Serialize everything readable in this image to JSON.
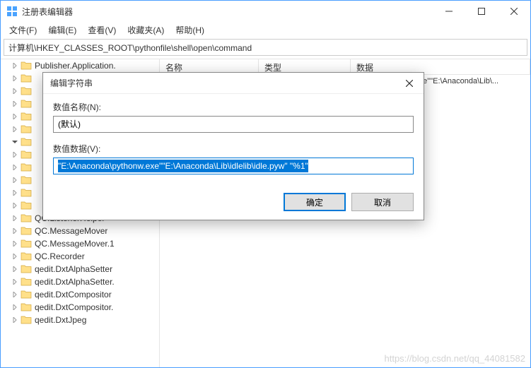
{
  "window": {
    "title": "注册表编辑器"
  },
  "titlebar_controls": {
    "min": "–",
    "max": "□",
    "close": "×"
  },
  "menu": {
    "file": "文件(F)",
    "edit": "编辑(E)",
    "view": "查看(V)",
    "favorites": "收藏夹(A)",
    "help": "帮助(H)"
  },
  "address": "计算机\\HKEY_CLASSES_ROOT\\pythonfile\\shell\\open\\command",
  "tree": [
    {
      "label": "Publisher.Application."
    },
    {
      "label": ""
    },
    {
      "label": ""
    },
    {
      "label": ""
    },
    {
      "label": ""
    },
    {
      "label": ""
    },
    {
      "label": "",
      "expanded": true
    },
    {
      "label": ""
    },
    {
      "label": ""
    },
    {
      "label": ""
    },
    {
      "label": ""
    },
    {
      "label": ""
    },
    {
      "label": "QC.ListenerHelper"
    },
    {
      "label": "QC.MessageMover"
    },
    {
      "label": "QC.MessageMover.1"
    },
    {
      "label": "QC.Recorder"
    },
    {
      "label": "qedit.DxtAlphaSetter"
    },
    {
      "label": "qedit.DxtAlphaSetter."
    },
    {
      "label": "qedit.DxtCompositor"
    },
    {
      "label": "qedit.DxtCompositor."
    },
    {
      "label": "qedit.DxtJpeg"
    }
  ],
  "list": {
    "headers": {
      "name": "名称",
      "type": "类型",
      "data": "数据"
    },
    "rows": [
      {
        "data": "aconda\\pythonw.exe\"\"E:\\Anaconda\\Lib\\..."
      }
    ]
  },
  "dialog": {
    "title": "编辑字符串",
    "name_label": "数值名称(N):",
    "name_value": "(默认)",
    "data_label": "数值数据(V):",
    "data_value": "\"E:\\Anaconda\\pythonw.exe\"\"E:\\Anaconda\\Lib\\idlelib\\idle.pyw\" \"%1\"",
    "ok": "确定",
    "cancel": "取消"
  },
  "watermark": "https://blog.csdn.net/qq_44081582"
}
